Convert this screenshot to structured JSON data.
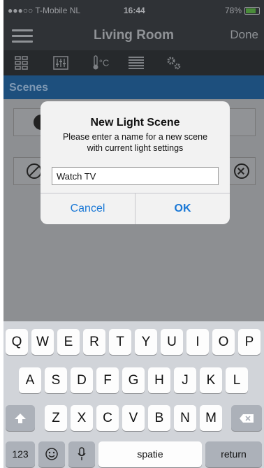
{
  "status_bar": {
    "carrier": "●●●○○ T-Mobile NL",
    "time": "16:44",
    "battery": "78%"
  },
  "nav": {
    "title": "Living Room",
    "done_label": "Done"
  },
  "toolbar": {
    "icons": [
      "scenes-grid-icon",
      "sliders-icon",
      "thermometer-icon",
      "blinds-icon",
      "settings-gears-icon"
    ],
    "thermo_text": "°C"
  },
  "section": {
    "title": "Scenes"
  },
  "alert": {
    "title": "New Light Scene",
    "message": "Please enter a name for a new scene with current light settings",
    "input_value": "Watch TV",
    "cancel_label": "Cancel",
    "ok_label": "OK"
  },
  "keyboard": {
    "row1": [
      "Q",
      "W",
      "E",
      "R",
      "T",
      "Y",
      "U",
      "I",
      "O",
      "P"
    ],
    "row2": [
      "A",
      "S",
      "D",
      "F",
      "G",
      "H",
      "J",
      "K",
      "L"
    ],
    "row3": [
      "Z",
      "X",
      "C",
      "V",
      "B",
      "N",
      "M"
    ],
    "numbers_label": "123",
    "space_label": "spatie",
    "return_label": "return"
  },
  "colors": {
    "accent": "#1a78d6",
    "section_bg": "#1d4f7d",
    "nav_bg": "#2f3236"
  }
}
